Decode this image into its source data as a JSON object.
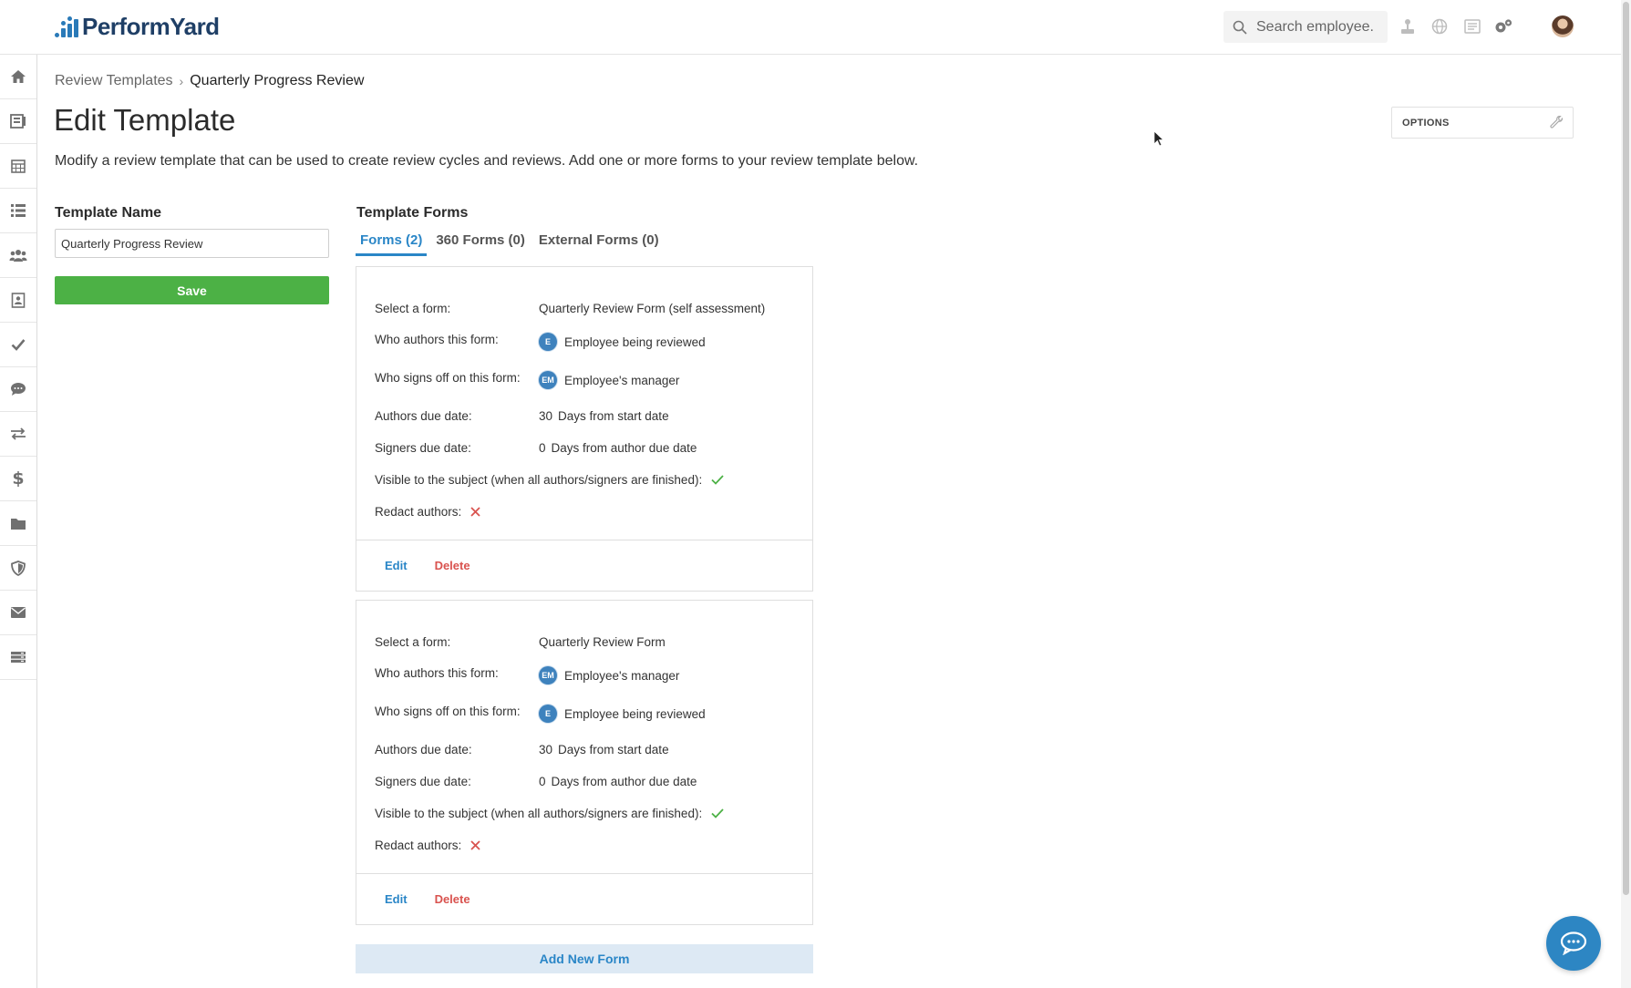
{
  "app": {
    "logo_text": "PerformYard",
    "brand_color": "#2a7ab8"
  },
  "header": {
    "search_placeholder": "Search employee...",
    "icons": [
      "org-chart-icon",
      "globe-icon",
      "news-icon",
      "settings-gear-icon",
      "user-avatar"
    ]
  },
  "sidebar": {
    "items": [
      "home-icon",
      "reviews-icon",
      "calendar-icon",
      "list-icon",
      "people-icon",
      "contact-card-icon",
      "checkmark-icon",
      "chat-icon",
      "transfer-arrows-icon",
      "dollar-icon",
      "folder-icon",
      "shield-icon",
      "envelope-icon",
      "storage-icon"
    ]
  },
  "breadcrumb": {
    "parent": "Review Templates",
    "separator": "›",
    "current": "Quarterly Progress Review"
  },
  "page": {
    "title": "Edit Template",
    "description": "Modify a review template that can be used to create review cycles and reviews. Add one or more forms to your review template below.",
    "options_label": "OPTIONS"
  },
  "template": {
    "name_label": "Template Name",
    "name_value": "Quarterly Progress Review",
    "save_label": "Save"
  },
  "forms_section": {
    "title": "Template Forms",
    "tabs": [
      "Forms (2)",
      "360 Forms (0)",
      "External Forms (0)"
    ],
    "active_tab": 0,
    "add_new_label": "Add New Form"
  },
  "labels": {
    "select_form": "Select a form:",
    "who_authors": "Who authors this form:",
    "who_signs": "Who signs off on this form:",
    "authors_due": "Authors due date:",
    "signers_due": "Signers due date:",
    "visible": "Visible to the subject (when all authors/signers are finished):",
    "redact": "Redact authors:",
    "edit": "Edit",
    "delete": "Delete"
  },
  "forms": [
    {
      "form_name": "Quarterly Review Form (self assessment)",
      "author_badge": "E",
      "author": "Employee being reviewed",
      "signer_badge": "EM",
      "signer": "Employee's manager",
      "authors_due_days": "30",
      "authors_due_text": "Days from start date",
      "signers_due_days": "0",
      "signers_due_text": "Days from author due date",
      "visible": true,
      "redact": false
    },
    {
      "form_name": "Quarterly Review Form",
      "author_badge": "EM",
      "author": "Employee's manager",
      "signer_badge": "E",
      "signer": "Employee being reviewed",
      "authors_due_days": "30",
      "authors_due_text": "Days from start date",
      "signers_due_days": "0",
      "signers_due_text": "Days from author due date",
      "visible": true,
      "redact": false
    }
  ],
  "colors": {
    "accent": "#2a86c7",
    "save_green": "#4cb145",
    "check_green": "#4cb145",
    "cross_red": "#d9534f"
  }
}
